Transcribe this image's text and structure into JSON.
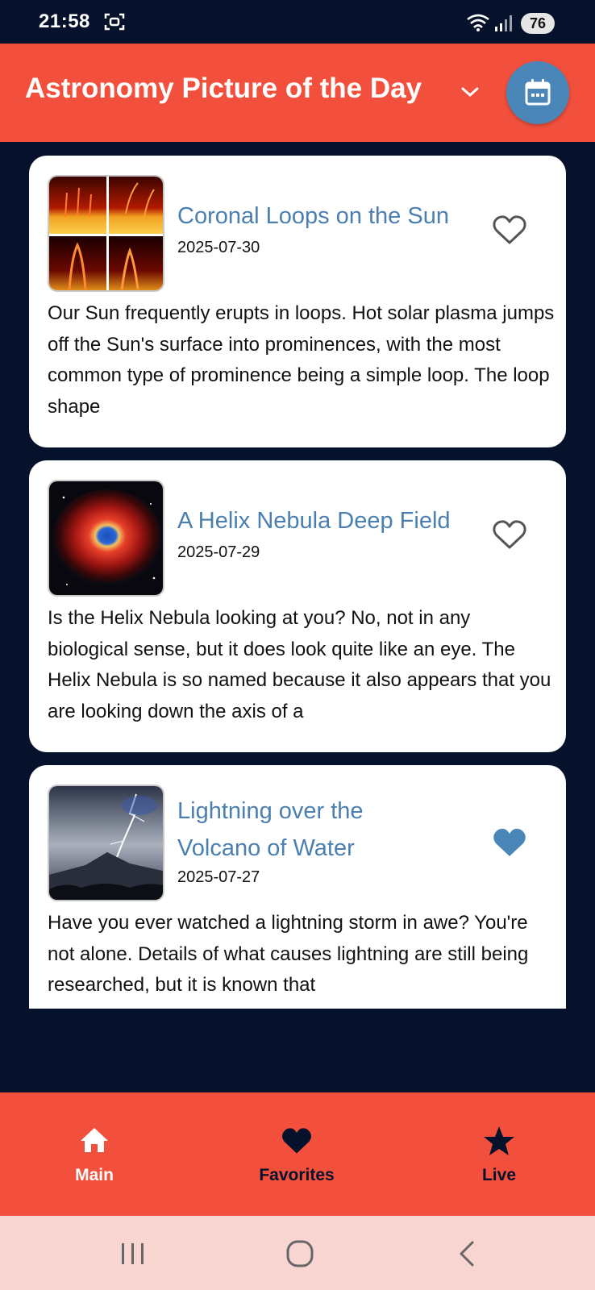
{
  "status_bar": {
    "time": "21:58",
    "battery": "76"
  },
  "app_bar": {
    "title": "Astronomy Picture of the Day"
  },
  "cards": [
    {
      "title": "Coronal Loops on the Sun",
      "date": "2025-07-30",
      "favorite": false,
      "text": "Our Sun frequently erupts in loops.  Hot solar plasma jumps off the Sun's surface into prominences, with the most common type of prominence being a simple loop.  The loop shape"
    },
    {
      "title": "A Helix Nebula Deep Field",
      "date": "2025-07-29",
      "favorite": false,
      "text": "Is the Helix Nebula looking at you? No, not in any biological sense, but it does look quite like an eye. The Helix Nebula is so named because it also appears that you are looking down the axis of a"
    },
    {
      "title": "Lightning over the Volcano of Water",
      "date": "2025-07-27",
      "favorite": true,
      "text": "Have you ever watched a lightning storm in awe? You're not alone. Details of what causes lightning are still being researched, but it is known that"
    }
  ],
  "bottom_nav": {
    "items": [
      {
        "label": "Main",
        "icon": "home-icon",
        "active": true
      },
      {
        "label": "Favorites",
        "icon": "heart-icon",
        "active": false
      },
      {
        "label": "Live",
        "icon": "star-icon",
        "active": false
      }
    ]
  },
  "colors": {
    "app_bar": "#f2503c",
    "background": "#06112b",
    "accent_blue": "#4a86b8",
    "title_blue": "#4a7fb0",
    "nav_active": "#ffffff",
    "nav_inactive": "#06112b"
  }
}
